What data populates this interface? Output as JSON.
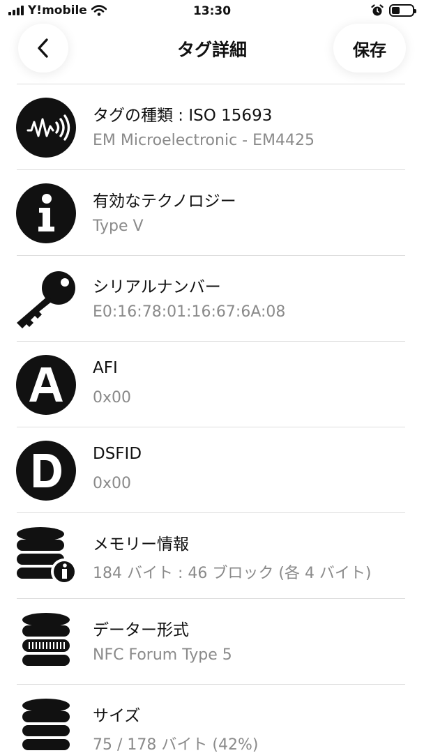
{
  "status_bar": {
    "carrier": "Y!mobile",
    "time": "13:30",
    "battery_level": 0.4
  },
  "nav": {
    "back_icon": "chevron-left-icon",
    "title": "タグ詳細",
    "save_label": "保存"
  },
  "rows": [
    {
      "icon": "nfc-wave-icon",
      "title": "タグの種類 : ISO 15693",
      "value": "EM Microelectronic - EM4425"
    },
    {
      "icon": "info-icon",
      "title": "有効なテクノロジー",
      "value": "Type V"
    },
    {
      "icon": "key-icon",
      "title": "シリアルナンバー",
      "value": "E0:16:78:01:16:67:6A:08"
    },
    {
      "icon": "letter-a-icon",
      "title": "AFI",
      "value": "0x00"
    },
    {
      "icon": "letter-d-icon",
      "title": "DSFID",
      "value": "0x00"
    },
    {
      "icon": "database-info-icon",
      "title": "メモリー情報",
      "value": "184 バイト : 46 ブロック (各 4 バイト)"
    },
    {
      "icon": "database-format-icon",
      "title": "データー形式",
      "value": "NFC Forum Type 5"
    },
    {
      "icon": "database-size-icon",
      "title": "サイズ",
      "value": "75 / 178 バイト (42%)"
    }
  ]
}
